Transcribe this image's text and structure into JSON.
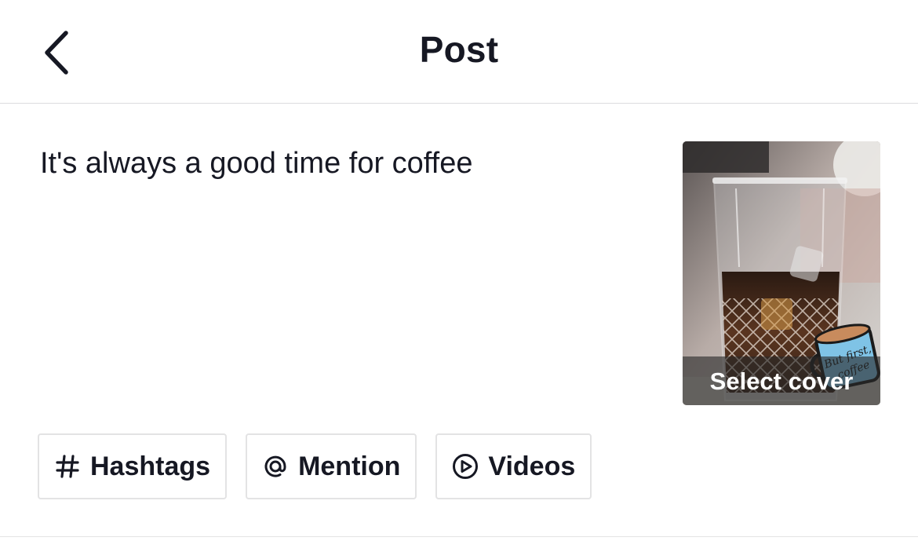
{
  "header": {
    "title": "Post",
    "back_icon": "chevron-left-icon"
  },
  "caption": {
    "text": "It's always a good time for coffee"
  },
  "cover": {
    "label": "Select cover",
    "sticker_text": "But first, coffee"
  },
  "chips": [
    {
      "icon": "hashtag-icon",
      "label": "Hashtags"
    },
    {
      "icon": "at-sign-icon",
      "label": "Mention"
    },
    {
      "icon": "play-circle-icon",
      "label": "Videos"
    }
  ],
  "colors": {
    "text_primary": "#161823",
    "divider": "#dcdcde",
    "chip_border": "#e3e3e4"
  }
}
